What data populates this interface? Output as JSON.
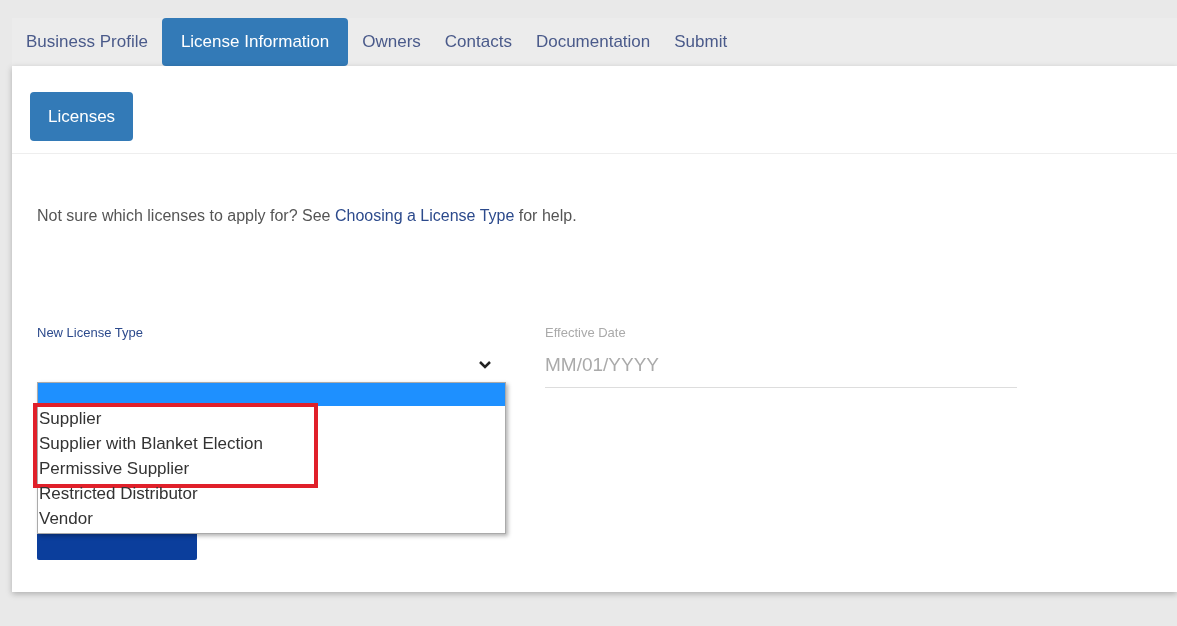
{
  "tabs": [
    {
      "label": "Business Profile",
      "selected": false
    },
    {
      "label": "License Information",
      "selected": true
    },
    {
      "label": "Owners",
      "selected": false
    },
    {
      "label": "Contacts",
      "selected": false
    },
    {
      "label": "Documentation",
      "selected": false
    },
    {
      "label": "Submit",
      "selected": false
    }
  ],
  "subtab": {
    "label": "Licenses",
    "selected": true
  },
  "help": {
    "before": "Not sure which licenses to apply for? See ",
    "link": "Choosing a License Type",
    "after": " for help."
  },
  "license_type": {
    "label": "New License Type",
    "expanded": true,
    "blank_option_selected": true,
    "options": [
      {
        "label": "Supplier",
        "highlighted": true
      },
      {
        "label": "Supplier with Blanket Election",
        "highlighted": true
      },
      {
        "label": "Permissive Supplier",
        "highlighted": true
      },
      {
        "label": "Restricted Distributor",
        "highlighted": false
      },
      {
        "label": "Vendor",
        "highlighted": false
      }
    ]
  },
  "effective_date": {
    "label": "Effective Date",
    "placeholder": "MM/01/YYYY"
  }
}
